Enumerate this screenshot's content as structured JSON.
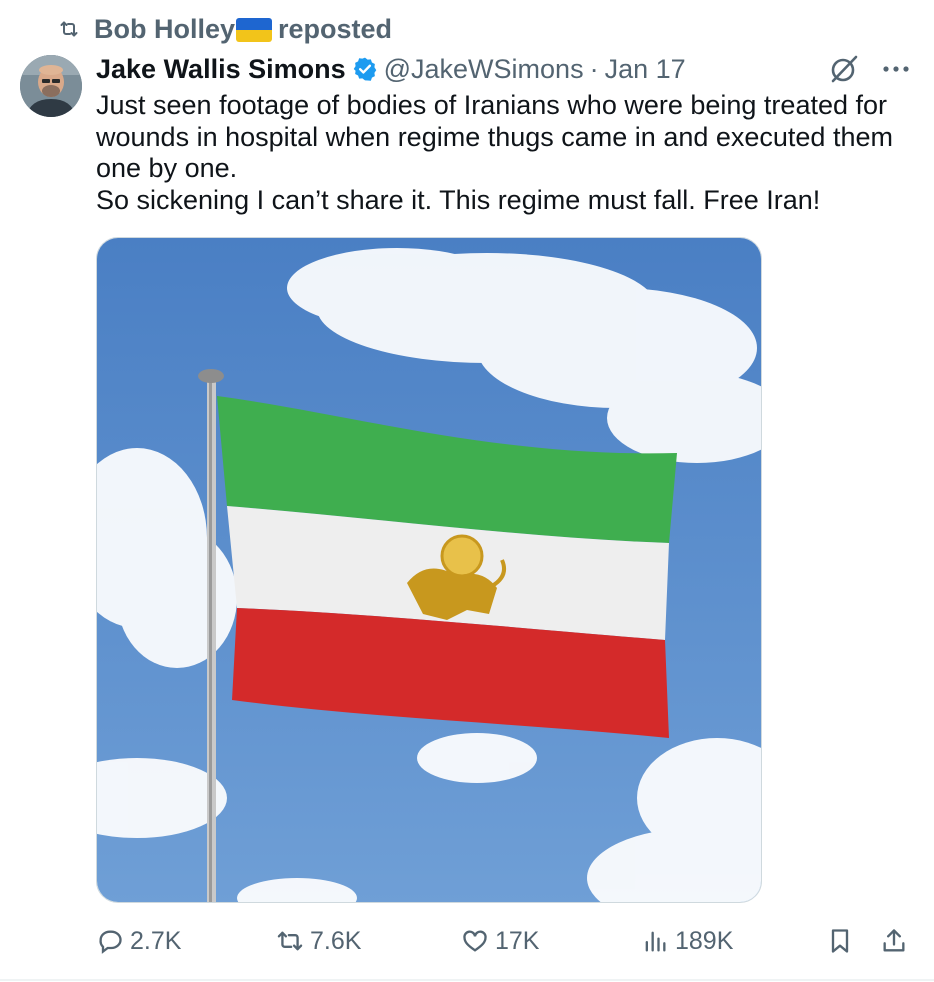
{
  "repost": {
    "reposter_name": "Bob Holley",
    "label": "reposted",
    "flag_emoji": "ukraine-flag"
  },
  "author": {
    "name": "Jake Wallis Simons",
    "handle": "@JakeWSimons",
    "separator": "·",
    "date": "Jan 17",
    "verified": true
  },
  "tweet": {
    "text": "Just seen footage of bodies of Iranians who were being treated for wounds in hospital when regime thugs came in and executed them one by one.\nSo sickening I can’t share it. This regime must fall. Free Iran!"
  },
  "media": {
    "type": "image",
    "icon": "iran-lion-and-sun-flag"
  },
  "metrics": {
    "replies": "2.7K",
    "reposts": "7.6K",
    "likes": "17K",
    "views": "189K"
  },
  "colors": {
    "text_primary": "#0f1419",
    "text_secondary": "#536471",
    "verified_blue": "#1d9bf0",
    "flag_green": "#3fae4f",
    "flag_white": "#eeeeee",
    "flag_red": "#d42a2a",
    "sky_blue": "#5b8fcf"
  }
}
